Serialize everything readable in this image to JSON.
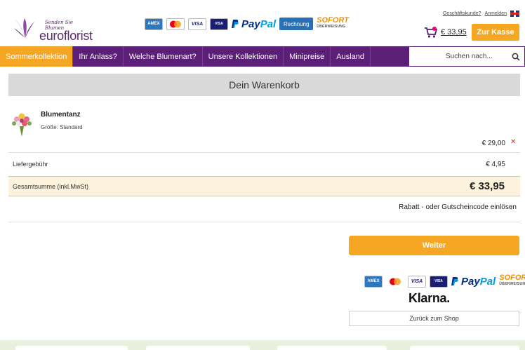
{
  "header": {
    "logo_tagline": "Senden Sie Blumen",
    "logo_name": "euroflorist",
    "payment_labels": {
      "paypal_a": "Pay",
      "paypal_b": "Pal",
      "rechnung": "Rechnung",
      "sofort": "SOFORT",
      "sofort_sub": "ÜBERWEISUNG"
    },
    "links": {
      "business": "Geschäftskunde?",
      "login": "Anmelden"
    },
    "cart_total": "€ 33,95",
    "checkout_label": "Zur Kasse"
  },
  "nav": {
    "items": [
      "Sommerkollektion",
      "Ihr Anlass?",
      "Welche Blumenart?",
      "Unsere Kollektionen",
      "Minipreise",
      "Ausland"
    ],
    "search_placeholder": "Suchen nach..."
  },
  "cart": {
    "title": "Dein Warenkorb",
    "item": {
      "name": "Blumentanz",
      "size": "Größe: Standard",
      "price": "€ 29,00"
    },
    "delivery_label": "Liefergebühr",
    "delivery_value": "€ 4,95",
    "total_label": "Gesamtsumme (inkl.MwSt)",
    "total_value": "€ 33,95",
    "coupon_label": "Rabatt - oder Gutscheincode einlösen",
    "continue_label": "Weiter",
    "klarna": "Klarna.",
    "back_label": "Zurück zum Shop"
  },
  "colors": {
    "purple": "#5b1f77",
    "orange": "#f5a623",
    "total_bg": "#fdf3dd"
  }
}
